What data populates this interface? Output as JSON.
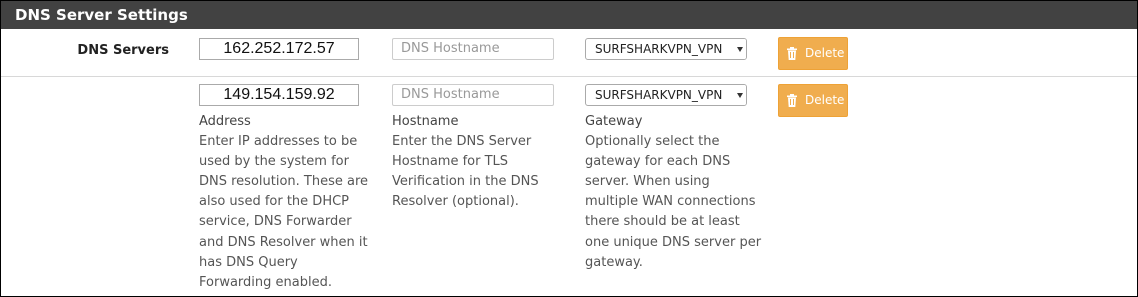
{
  "panel": {
    "title": "DNS Server Settings"
  },
  "row_label": "DNS Servers",
  "servers": [
    {
      "address": "162.252.172.57",
      "hostname_placeholder": "DNS Hostname",
      "gateway": "SURFSHARKVPN_VPN",
      "delete_label": "Delete"
    },
    {
      "address": "149.154.159.92",
      "hostname_placeholder": "DNS Hostname",
      "gateway": "SURFSHARKVPN_VPN",
      "delete_label": "Delete"
    }
  ],
  "help": {
    "address_title": "Address",
    "address_lines": [
      "Enter IP addresses to be",
      "used by the system for",
      "DNS resolution. These are",
      "also used for the DHCP",
      "service, DNS Forwarder",
      "and DNS Resolver when it",
      "has DNS Query",
      "Forwarding enabled."
    ],
    "hostname_title": "Hostname",
    "hostname_lines": [
      "Enter the DNS Server",
      "Hostname for TLS",
      "Verification in the DNS",
      "Resolver (optional)."
    ],
    "gateway_title": "Gateway",
    "gateway_lines": [
      "Optionally select the",
      "gateway for each DNS",
      "server. When using",
      "multiple WAN connections",
      "there should be at least",
      "one unique DNS server per",
      "gateway."
    ]
  },
  "colors": {
    "header_bg": "#424242",
    "delete_button": "#f0ad4e"
  },
  "icons": {
    "delete": "trash-icon",
    "select": "chevron-down-icon"
  }
}
